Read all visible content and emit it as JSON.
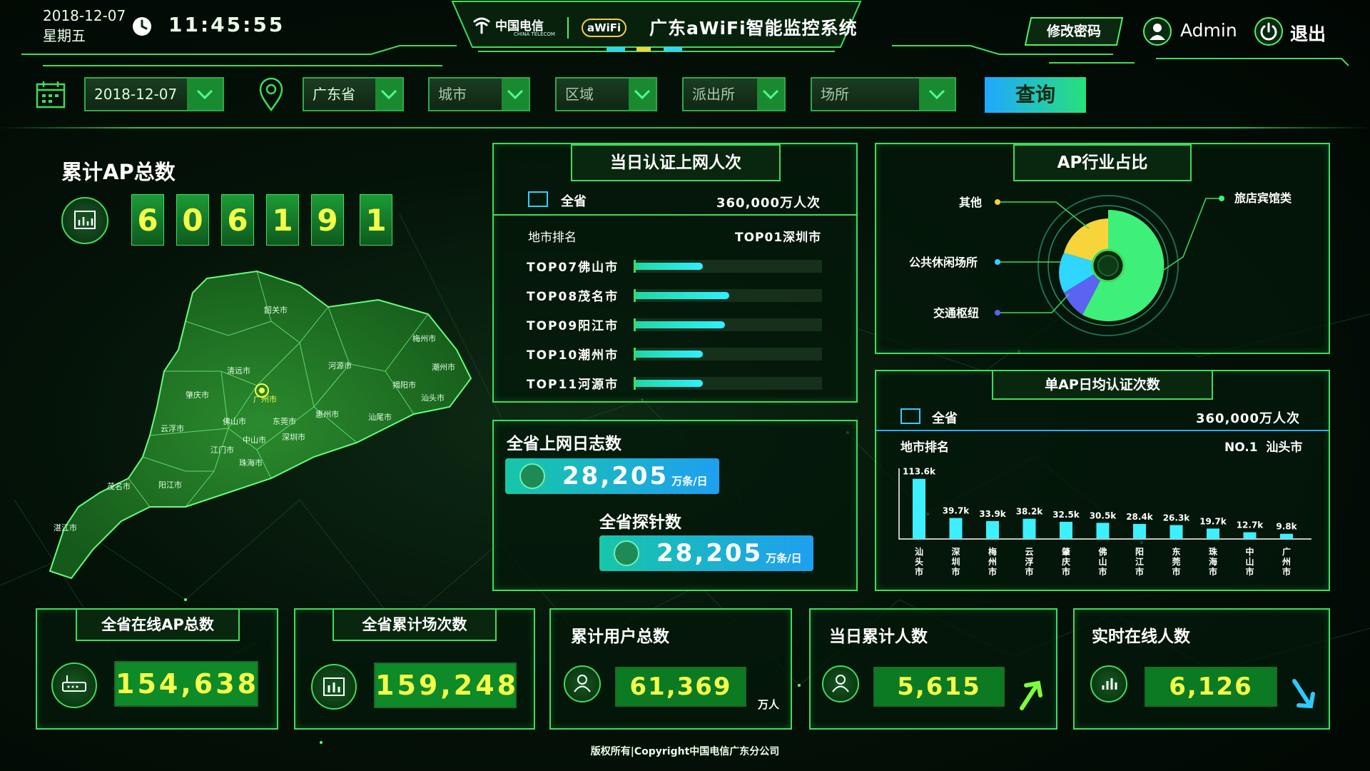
{
  "header": {
    "date": "2018-12-07",
    "weekday": "星期五",
    "time": "11:45:55",
    "brand_cn": "中国电信",
    "brand_en": "CHINA TELECOM",
    "awifi": "aWiFi",
    "system_title": "广东aWiFi智能监控系统",
    "change_password": "修改密码",
    "user_name": "Admin",
    "logout": "退出"
  },
  "filters": {
    "date_value": "2018-12-07",
    "province_value": "广东省",
    "city_placeholder": "城市",
    "district_placeholder": "区域",
    "police_placeholder": "派出所",
    "venue_placeholder": "场所",
    "query_button": "查询"
  },
  "ap_total": {
    "title": "累计AP总数",
    "digits": [
      "6",
      "0",
      "6",
      "1",
      "9",
      "1"
    ]
  },
  "map": {
    "cities": [
      {
        "name": "韶关市"
      },
      {
        "name": "清远市"
      },
      {
        "name": "河源市"
      },
      {
        "name": "梅州市"
      },
      {
        "name": "潮州市"
      },
      {
        "name": "揭阳市"
      },
      {
        "name": "汕头市"
      },
      {
        "name": "肇庆市"
      },
      {
        "name": "广州市"
      },
      {
        "name": "惠州市"
      },
      {
        "name": "汕尾市"
      },
      {
        "name": "云浮市"
      },
      {
        "name": "佛山市"
      },
      {
        "name": "东莞市"
      },
      {
        "name": "中山市"
      },
      {
        "name": "深圳市"
      },
      {
        "name": "江门市"
      },
      {
        "name": "珠海市"
      },
      {
        "name": "茂名市"
      },
      {
        "name": "阳江市"
      },
      {
        "name": "湛江市"
      }
    ]
  },
  "daily_auth": {
    "title": "当日认证上网人次",
    "scope_label": "全省",
    "scope_value": "360,000万人次",
    "rank_label": "地市排名",
    "rank_top": "TOP01深圳市",
    "rows": [
      {
        "label": "TOP07佛山市",
        "ratio": 0.36
      },
      {
        "label": "TOP08茂名市",
        "ratio": 0.5
      },
      {
        "label": "TOP09阳江市",
        "ratio": 0.48
      },
      {
        "label": "TOP10潮州市",
        "ratio": 0.36
      },
      {
        "label": "TOP11河源市",
        "ratio": 0.36
      }
    ]
  },
  "logs": {
    "title1": "全省上网日志数",
    "value1": "28,205",
    "unit1": "万条/日",
    "title2": "全省探针数",
    "value2": "28,205",
    "unit2": "万条/日"
  },
  "industry": {
    "title": "AP行业占比",
    "labels": {
      "other": "其他",
      "hotel": "旅店宾馆类",
      "leisure": "公共休闲场所",
      "transport": "交通枢纽"
    },
    "colors": {
      "hotel": "#3ef07a",
      "other": "#f6d43a",
      "leisure": "#2fd6ff",
      "transport": "#5b63f0"
    }
  },
  "per_ap": {
    "title": "单AP日均认证次数",
    "scope_label": "全省",
    "scope_value": "360,000万人次",
    "rank_label": "地市排名",
    "rank_top": "NO.1  汕头市"
  },
  "chart_data": {
    "type": "bar",
    "categories": [
      "汕头市",
      "深圳市",
      "梅州市",
      "云浮市",
      "肇庆市",
      "佛山市",
      "阳江市",
      "东莞市",
      "珠海市",
      "中山市",
      "广州市"
    ],
    "values": [
      113.6,
      39.7,
      33.9,
      38.2,
      32.5,
      30.5,
      28.4,
      26.3,
      19.7,
      12.7,
      9.8
    ],
    "value_labels": [
      "113.6k",
      "39.7k",
      "33.9k",
      "38.2k",
      "32.5k",
      "30.5k",
      "28.4k",
      "26.3k",
      "19.7k",
      "12.7k",
      "9.8k"
    ],
    "ylim": [
      0,
      120
    ],
    "bar_color": "#3ef0ff"
  },
  "bottom": {
    "online_ap": {
      "title": "全省在线AP总数",
      "value": "154,638"
    },
    "venue_count": {
      "title": "全省累计场次数",
      "value": "159,248"
    },
    "total_users": {
      "title": "累计用户总数",
      "value": "61,369",
      "unit": "万人"
    },
    "daily_users": {
      "title": "当日累计人数",
      "value": "5,615"
    },
    "online_now": {
      "title": "实时在线人数",
      "value": "6,126"
    }
  },
  "footer": "版权所有|Copyright中国电信广东分公司"
}
